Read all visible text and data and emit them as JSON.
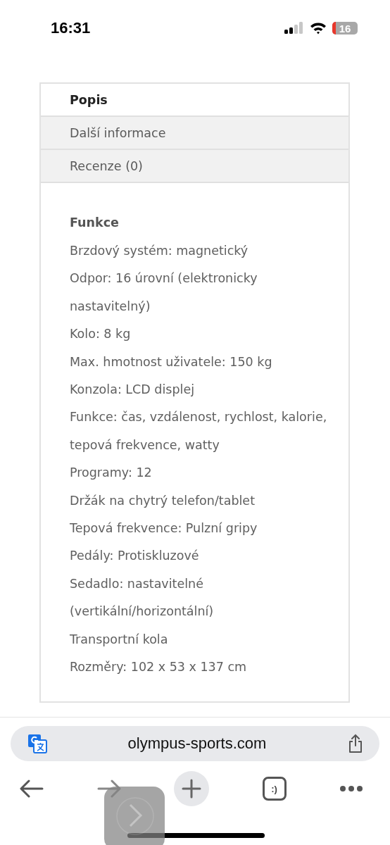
{
  "status_bar": {
    "time": "16:31",
    "battery": "16"
  },
  "tabs": [
    {
      "label": "Popis",
      "selected": true
    },
    {
      "label": "Další informace",
      "selected": false
    },
    {
      "label": "Recenze (0)",
      "selected": false
    }
  ],
  "panel": {
    "heading": "Funkce",
    "lines": [
      "Brzdový systém: magnetický",
      "Odpor: 16 úrovní (elektronicky nastavitelný)",
      "Kolo: 8 kg",
      "Max. hmotnost uživatele: 150 kg",
      "Konzola: LCD displej",
      "Funkce: čas, vzdálenost, rychlost, kalorie, tepová frekvence, watty",
      "Programy: 12",
      "Držák na chytrý telefon/tablet",
      "Tepová frekvence: Pulzní gripy",
      "Pedály: Protiskluzové",
      "Sedadlo: nastavitelné (vertikální/horizontální)",
      "Transportní kola",
      "Rozměry: 102 x 53 x 137 cm"
    ]
  },
  "address_bar": {
    "url": "olympus-sports.com"
  },
  "toolbar": {
    "tabs_label": ":)"
  }
}
